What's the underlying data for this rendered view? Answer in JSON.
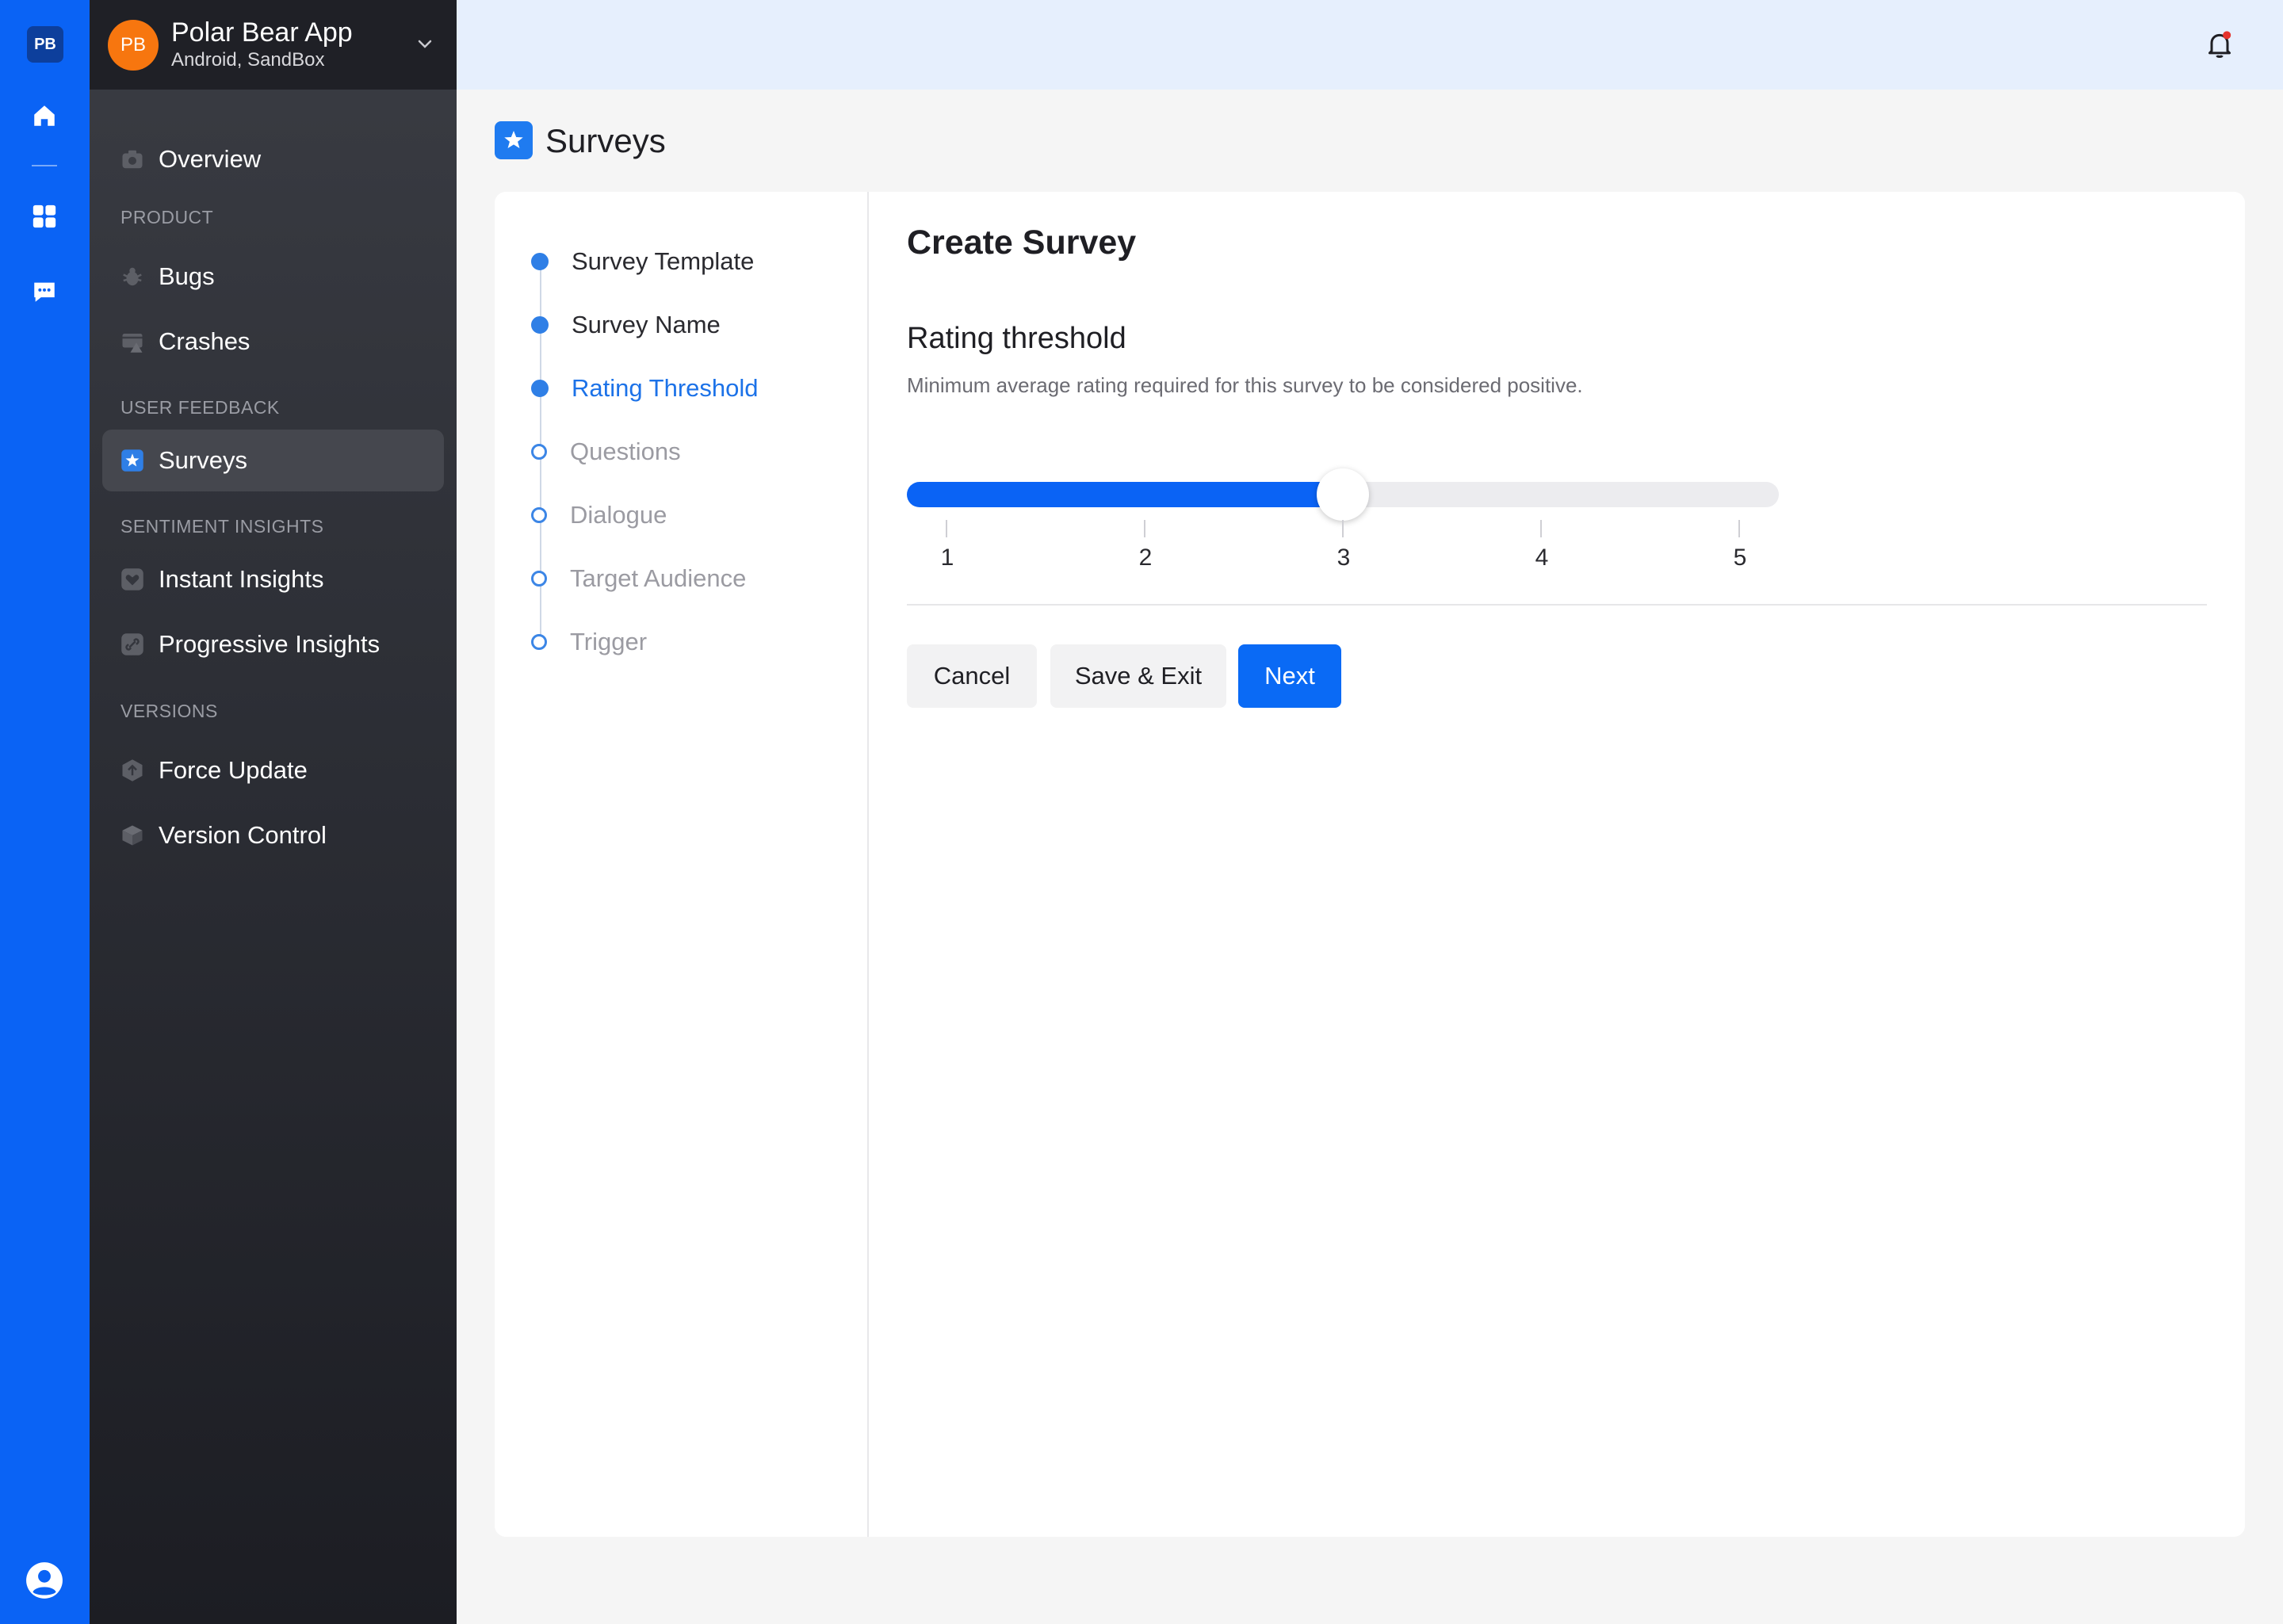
{
  "workspace": {
    "badge": "PB"
  },
  "rail": {
    "items": [
      "home-icon",
      "dashboard-icon",
      "chat-icon"
    ],
    "profile_icon": "user-icon"
  },
  "app": {
    "initials": "PB",
    "name": "Polar Bear App",
    "environment": "Android, SandBox"
  },
  "sidebar": {
    "overview": "Overview",
    "sections": {
      "product": "PRODUCT",
      "user_feedback": "USER FEEDBACK",
      "sentiment": "SENTIMENT INSIGHTS",
      "versions": "VERSIONS"
    },
    "items": {
      "bugs": "Bugs",
      "crashes": "Crashes",
      "surveys": "Surveys",
      "instant_insights": "Instant Insights",
      "progressive_insights": "Progressive Insights",
      "force_update": "Force Update",
      "version_control": "Version Control"
    },
    "active": "Surveys"
  },
  "header": {
    "bell_icon": "bell-icon",
    "has_notification": true
  },
  "page": {
    "title": "Surveys"
  },
  "steps": [
    {
      "label": "Survey Template",
      "state": "done"
    },
    {
      "label": "Survey Name",
      "state": "done"
    },
    {
      "label": "Rating Threshold",
      "state": "current"
    },
    {
      "label": "Questions",
      "state": "pending"
    },
    {
      "label": "Dialogue",
      "state": "pending"
    },
    {
      "label": "Target Audience",
      "state": "pending"
    },
    {
      "label": "Trigger",
      "state": "pending"
    }
  ],
  "form": {
    "title": "Create Survey",
    "field_title": "Rating threshold",
    "field_description": "Minimum average rating required for this survey to be considered positive.",
    "slider": {
      "min": 1,
      "max": 5,
      "value": 3,
      "ticks": [
        "1",
        "2",
        "3",
        "4",
        "5"
      ]
    },
    "buttons": {
      "cancel": "Cancel",
      "save_exit": "Save & Exit",
      "next": "Next"
    }
  },
  "colors": {
    "accent": "#0a63f5",
    "sidebar_bg": "#2c2e35",
    "avatar": "#f7760f",
    "notification_dot": "#e5322d"
  }
}
